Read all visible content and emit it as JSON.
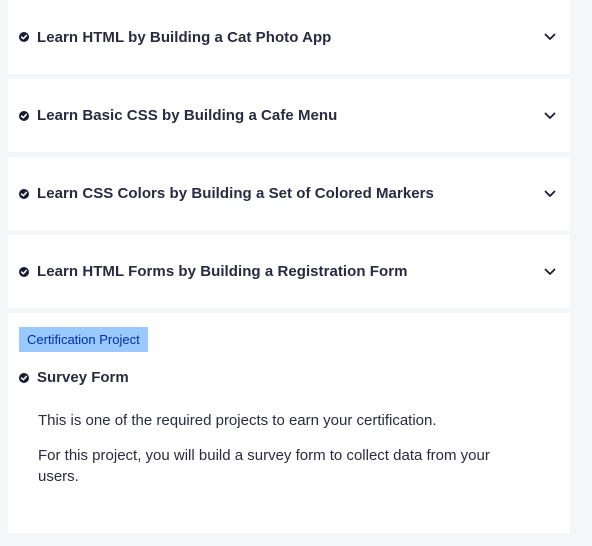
{
  "blocks": [
    {
      "title": "Learn HTML by Building a Cat Photo App"
    },
    {
      "title": "Learn Basic CSS by Building a Cafe Menu"
    },
    {
      "title": "Learn CSS Colors by Building a Set of Colored Markers"
    },
    {
      "title": "Learn HTML Forms by Building a Registration Form"
    }
  ],
  "certification": {
    "badge": "Certification Project",
    "project_title": "Survey Form",
    "description": [
      "This is one of the required projects to earn your certification.",
      "For this project, you will build a survey form to collect data from your users."
    ]
  },
  "icons": {
    "completed": "check-circle-icon",
    "expand": "chevron-down-icon"
  },
  "colors": {
    "page_background": "#f5f6f7",
    "card_background": "#ffffff",
    "badge_background": "#99c9ff",
    "badge_text": "#002ead",
    "text": "#2a2a40"
  }
}
